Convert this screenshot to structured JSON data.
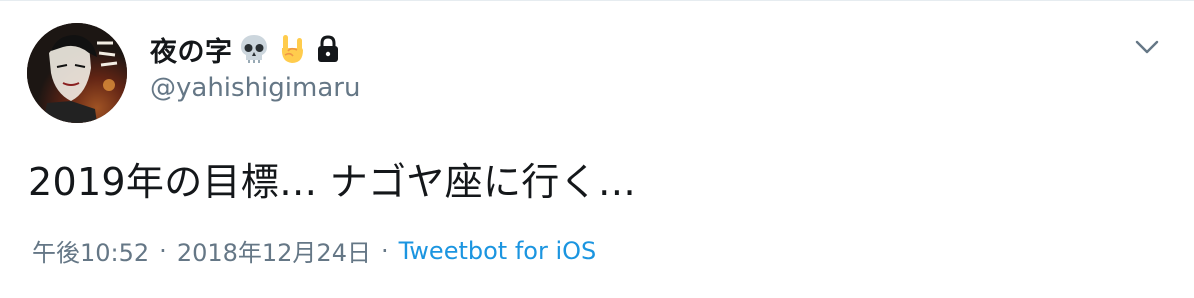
{
  "user": {
    "display_name": "夜の字",
    "handle": "@yahishigimaru",
    "badge_icons": [
      "skull-icon",
      "rock-hand-icon"
    ],
    "protected_icon": "lock-icon"
  },
  "tweet": {
    "text": "2019年の目標… ナゴヤ座に行く…",
    "time": "午後10:52",
    "date": "2018年12月24日",
    "separator": "·",
    "source": "Tweetbot for iOS"
  },
  "menu": {
    "icon": "chevron-down-icon"
  },
  "colors": {
    "text_primary": "#14171a",
    "text_secondary": "#657786",
    "link": "#1b95e0",
    "border": "#e6ecf0"
  }
}
